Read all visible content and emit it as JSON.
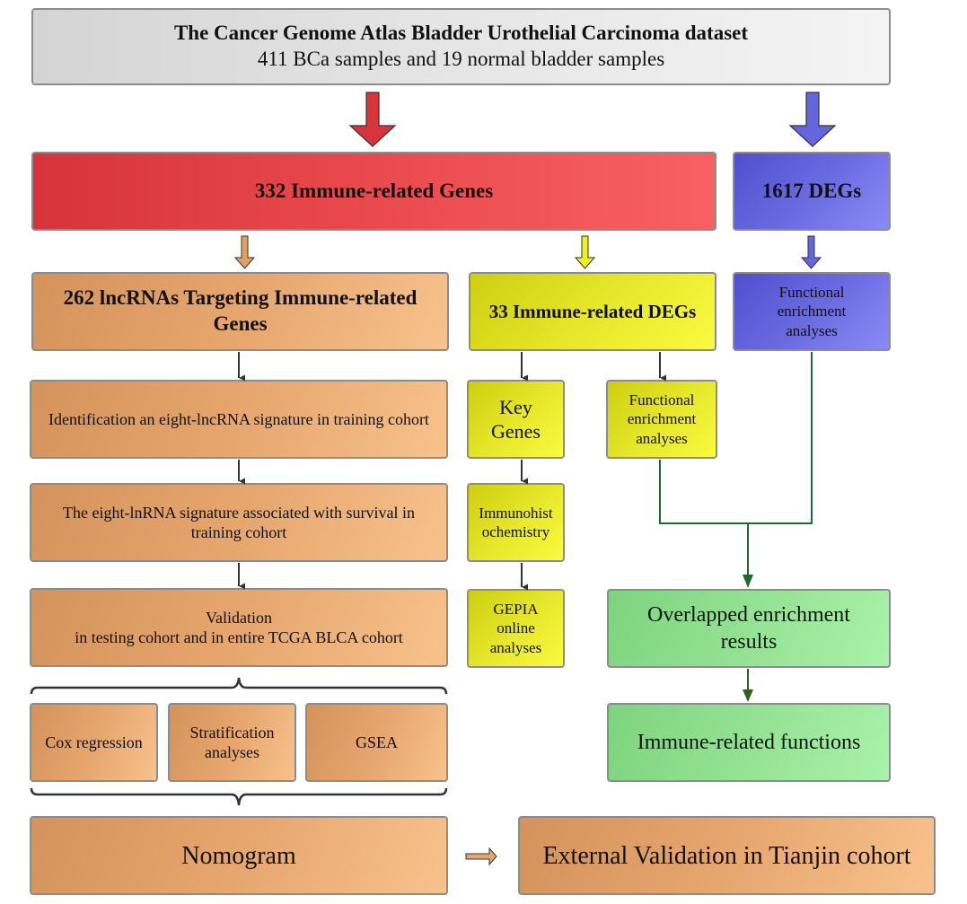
{
  "dataset": {
    "title": "The Cancer Genome Atlas Bladder Urothelial Carcinoma dataset",
    "subtitle": "411 BCa samples and 19 normal bladder samples"
  },
  "immune_genes": {
    "label": "332 Immune-related Genes"
  },
  "degs": {
    "label": "1617 DEGs"
  },
  "lncrna_targets": {
    "label": "262 lncRNAs Targeting Immune-related Genes"
  },
  "immune_degs": {
    "label": "33 Immune-related DEGs"
  },
  "deg_enrichment": {
    "label": "Functional enrichment analyses"
  },
  "signature_identification": {
    "label": "Identification an eight-lncRNA signature in training cohort"
  },
  "key_genes": {
    "label": "Key Genes"
  },
  "immune_deg_enrichment": {
    "label": "Functional enrichment analyses"
  },
  "signature_survival": {
    "label": "The eight-lnRNA signature associated with survival in training cohort"
  },
  "immunohistochemistry": {
    "label": "Immunohist ochemistry"
  },
  "validation": {
    "line1": "Validation",
    "line2": "in testing cohort and in entire TCGA BLCA cohort"
  },
  "gepia": {
    "label": "GEPIA online analyses"
  },
  "overlapped": {
    "label": "Overlapped enrichment results"
  },
  "analyses": [
    {
      "label": "Cox regression"
    },
    {
      "label": "Stratification analyses"
    },
    {
      "label": "GSEA"
    }
  ],
  "immune_functions": {
    "label": "Immune-related functions"
  },
  "nomogram": {
    "label": "Nomogram"
  },
  "external_validation": {
    "label": "External Validation in Tianjin cohort"
  },
  "colors": {
    "red": "#e8474b",
    "blue": "#6a6ae0",
    "orange": "#e6a66e",
    "yellow": "#e6e62a",
    "green": "#94e294",
    "connector_dark": "#333333",
    "connector_green": "#1f6b2f"
  }
}
